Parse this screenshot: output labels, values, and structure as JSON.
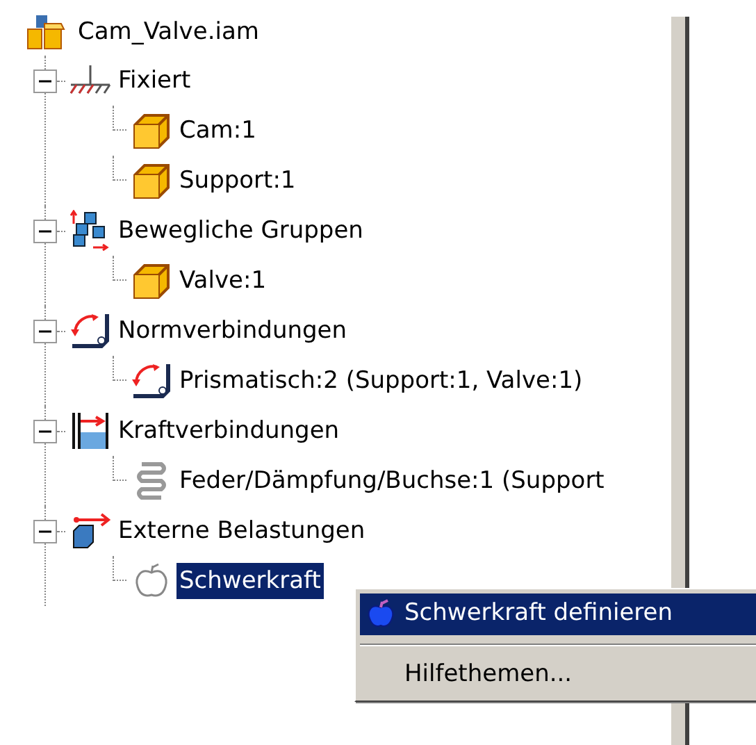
{
  "tree": {
    "label": "Cam_Valve.iam",
    "kind": "assembly",
    "selected": false,
    "children": [
      {
        "label": "Fixiert",
        "kind": "ground",
        "selected": false,
        "expanded": true,
        "children": [
          {
            "label": "Cam:1",
            "kind": "part",
            "selected": false
          },
          {
            "label": "Support:1",
            "kind": "part",
            "selected": false
          }
        ]
      },
      {
        "label": "Bewegliche Gruppen",
        "kind": "group",
        "selected": false,
        "expanded": true,
        "children": [
          {
            "label": "Valve:1",
            "kind": "part",
            "selected": false
          }
        ]
      },
      {
        "label": "Normverbindungen",
        "kind": "joint",
        "selected": false,
        "expanded": true,
        "children": [
          {
            "label": "Prismatisch:2 (Support:1, Valve:1)",
            "kind": "joint",
            "selected": false
          }
        ]
      },
      {
        "label": "Kraftverbindungen",
        "kind": "force",
        "selected": false,
        "expanded": true,
        "children": [
          {
            "label": "Feder/Dämpfung/Buchse:1 (Support",
            "kind": "spring",
            "selected": false
          }
        ]
      },
      {
        "label": "Externe Belastungen",
        "kind": "load",
        "selected": false,
        "expanded": true,
        "children": [
          {
            "label": "Schwerkraft",
            "kind": "gravity",
            "selected": true
          }
        ]
      }
    ]
  },
  "context_menu": {
    "items": [
      {
        "label": "Schwerkraft definieren",
        "kind": "gravity",
        "selected": true
      },
      {
        "label": "Hilfethemen...",
        "kind": "plain",
        "selected": false
      }
    ]
  }
}
